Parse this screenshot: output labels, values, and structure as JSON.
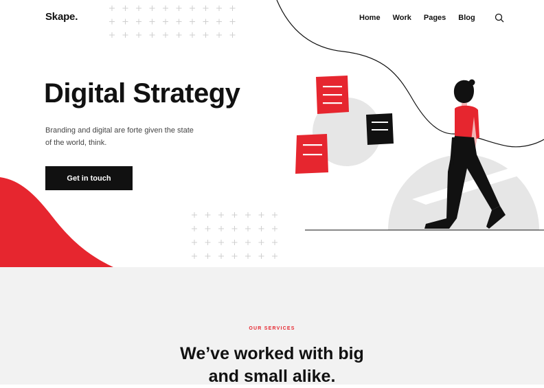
{
  "brand": {
    "logo": "Skape."
  },
  "nav": {
    "items": [
      {
        "label": "Home"
      },
      {
        "label": "Work"
      },
      {
        "label": "Pages"
      },
      {
        "label": "Blog"
      }
    ],
    "search_icon": "search-icon"
  },
  "hero": {
    "title": "Digital Strategy",
    "subtitle": "Branding and digital are forte given the state of the world, think.",
    "cta_label": "Get in touch"
  },
  "services": {
    "eyebrow": "OUR SERVICES",
    "heading_line1": "We’ve worked with big",
    "heading_line2": "and small alike."
  },
  "colors": {
    "accent": "#e6262f",
    "dark": "#111111",
    "light_gray": "#e6e6e6",
    "section_bg": "#f2f2f2"
  }
}
